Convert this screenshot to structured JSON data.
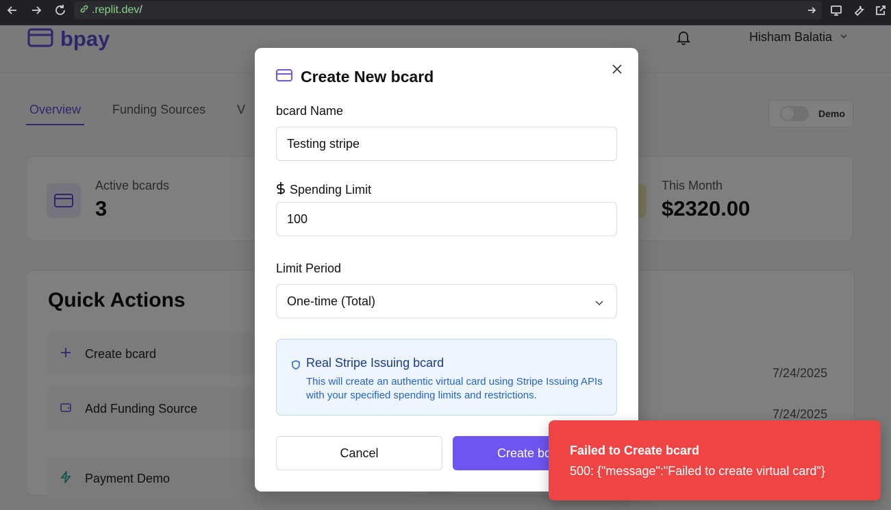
{
  "browser": {
    "url_prefix": ".replit.dev",
    "url_suffix": "/"
  },
  "app": {
    "name": "bpay",
    "user_name": "Hisham Balatia"
  },
  "tabs": [
    {
      "label": "Overview"
    },
    {
      "label": "Funding Sources"
    },
    {
      "label": "V"
    }
  ],
  "demo_toggle": {
    "label": "Demo"
  },
  "stats": [
    {
      "label": "Active bcards",
      "value": "3"
    },
    {
      "label": "This Month",
      "value": "$2320.00"
    }
  ],
  "quick_actions": {
    "title": "Quick Actions",
    "items": [
      {
        "label": "Create bcard"
      },
      {
        "label": "Add Funding Source"
      },
      {
        "label": "Payment Demo"
      }
    ]
  },
  "recent_dates": [
    "7/24/2025",
    "7/24/2025"
  ],
  "modal": {
    "title": "Create New bcard",
    "name_label": "bcard Name",
    "name_value": "Testing stripe",
    "limit_label": "Spending Limit",
    "limit_value": "100",
    "period_label": "Limit Period",
    "period_value": "One-time (Total)",
    "info_title": "Real Stripe Issuing bcard",
    "info_text": "This will create an authentic virtual card using Stripe Issuing APIs with your specified spending limits and restrictions.",
    "cancel_label": "Cancel",
    "create_label": "Create bcard"
  },
  "toast": {
    "title": "Failed to Create bcard",
    "message": "500: {\"message\":\"Failed to create virtual card\"}"
  },
  "colors": {
    "accent": "#6c55f0",
    "toast": "#ef4444",
    "info_bg": "#edf5fe"
  }
}
